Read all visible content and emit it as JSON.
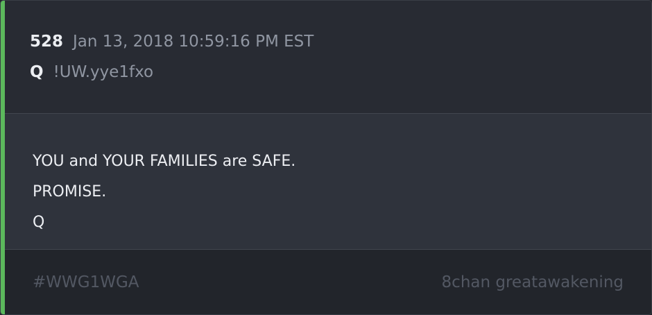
{
  "post": {
    "number": "528",
    "date": "Jan 13, 2018 10:59:16 PM EST",
    "author": "Q",
    "tripcode": "!UW.yye1fxo"
  },
  "message": {
    "lines": [
      "YOU and YOUR FAMILIES are SAFE.",
      "PROMISE.",
      "Q"
    ]
  },
  "footer": {
    "hashtag": "#WWG1WGA",
    "source": "8chan greatawakening"
  },
  "colors": {
    "accent": "#5cb85c",
    "background": "#282b33",
    "body_background": "#2f333c",
    "footer_background": "#22252b"
  }
}
